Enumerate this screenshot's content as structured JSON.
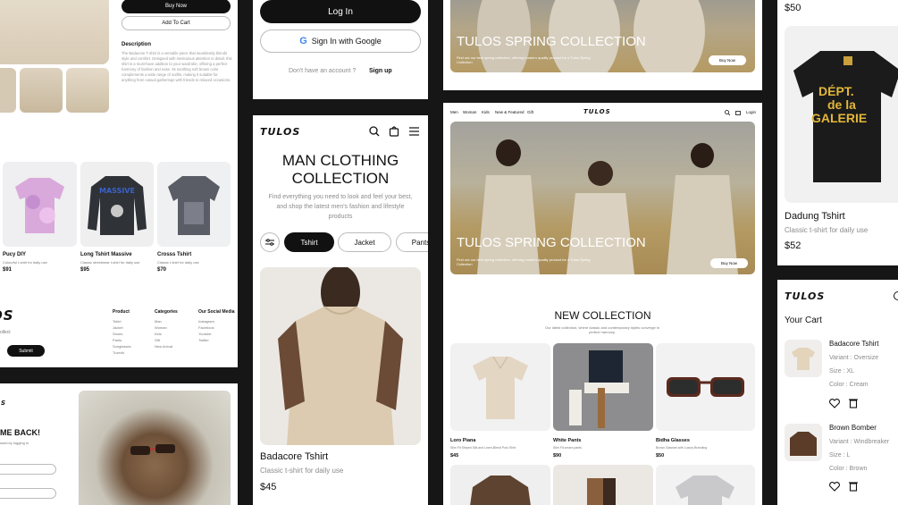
{
  "product_detail": {
    "buy_now": "Buy Now",
    "add_to_cart": "Add To Cart",
    "description_heading": "Description",
    "description_text": "The Badacore T-shirt is a versatile piece that seamlessly blends style and comfort. Designed with meticulous attention to detail, this shirt is a must-have addition to your wardrobe, offering a perfect harmony of fashion and ease. Its soothing soft brown color complements a wide range of outfits, making it suitable for anything from casual gatherings with friends to relaxed occasions."
  },
  "product_grid": {
    "items": [
      {
        "name": "Pucy DIY",
        "desc": "Colourful t-shirt for daily use",
        "price": "$91"
      },
      {
        "name": "Long Tshirt Massive",
        "desc": "Classic streetwear t-shirt for daily use",
        "price": "$95"
      },
      {
        "name": "Crosss Tshirt",
        "desc": "Classic t-shirt for daily use",
        "price": "$70"
      }
    ]
  },
  "footer": {
    "subscribe_text": "ollect",
    "submit": "Submit",
    "columns": [
      {
        "title": "Product",
        "links": [
          "Tshirt",
          "Jacket",
          "Shoes",
          "Pants",
          "Sunglasses",
          "Tuxedo"
        ]
      },
      {
        "title": "Categories",
        "links": [
          "Man",
          "Woman",
          "Kids",
          "Gift",
          "New Arrival"
        ]
      },
      {
        "title": "Our Social Media",
        "links": [
          "Instagram",
          "Facebook",
          "Youtube",
          "Twitter"
        ]
      }
    ]
  },
  "welcome": {
    "heading": "ME BACK!",
    "subtext": "ssed by logging in"
  },
  "login": {
    "login_button": "Log In",
    "google_button": "Sign In with Google",
    "no_account": "Don't have an account ?",
    "signup": "Sign up"
  },
  "mobile": {
    "brand": "TULOS",
    "title_line1": "MAN CLOTHING",
    "title_line2": "COLLECTION",
    "subtitle_line1": "Find everything you need to look and feel your best,",
    "subtitle_line2": "and shop the latest men's fashion and lifestyle",
    "subtitle_line3": "products",
    "filters": [
      "Tshirt",
      "Jacket",
      "Pants"
    ],
    "product_name": "Badacore Tshirt",
    "product_desc": "Classic t-shirt for daily use",
    "product_price": "$45"
  },
  "desktop": {
    "nav": [
      "Men",
      "Woman",
      "Kids",
      "New & Featured",
      "Gift"
    ],
    "brand": "TULOS",
    "login": "Login",
    "hero_title": "TULOS SPRING COLLECTION",
    "hero_sub": "Find out our best spring collection, offering modern quality product for a Tulos Spring Collection",
    "hero_button": "Buy Now",
    "collection_title": "NEW COLLECTION",
    "collection_sub": "Our latest collection, where classic and contemporary styles converge in perfect harmony.",
    "products": [
      {
        "name": "Loro Piana",
        "desc": "Slim Fit Striped Silk and Linen-Blend Polo Shirt",
        "price": "$45"
      },
      {
        "name": "White Pants",
        "desc": "Slim Fit cream pants",
        "price": "$90"
      },
      {
        "name": "Bidha Glasses",
        "desc": "Brown Glasses with Luxury Branding",
        "price": "$50"
      }
    ]
  },
  "top_hero": {
    "title": "TULOS SPRING COLLECTION",
    "sub": "Find out our best spring collection, offering modern quality product for a Tulos Spring Collection",
    "button": "Buy Now"
  },
  "right_product": {
    "price_top": "$50",
    "shirt_print_line1": "DÉPT.",
    "shirt_print_line2": "de la",
    "shirt_print_line3": "GALERIE",
    "name": "Dadung Tshirt",
    "desc": "Classic t-shirt for daily use",
    "price": "$52"
  },
  "cart": {
    "brand": "TULOS",
    "title": "Your Cart",
    "items": [
      {
        "name": "Badacore Tshirt",
        "variant": "Variant : Oversize",
        "size": "Size : XL",
        "color": "Color : Cream"
      },
      {
        "name": "Brown Bomber",
        "variant": "Variant : Windbreaker",
        "size": "Size : L",
        "color": "Color : Brown"
      }
    ]
  }
}
